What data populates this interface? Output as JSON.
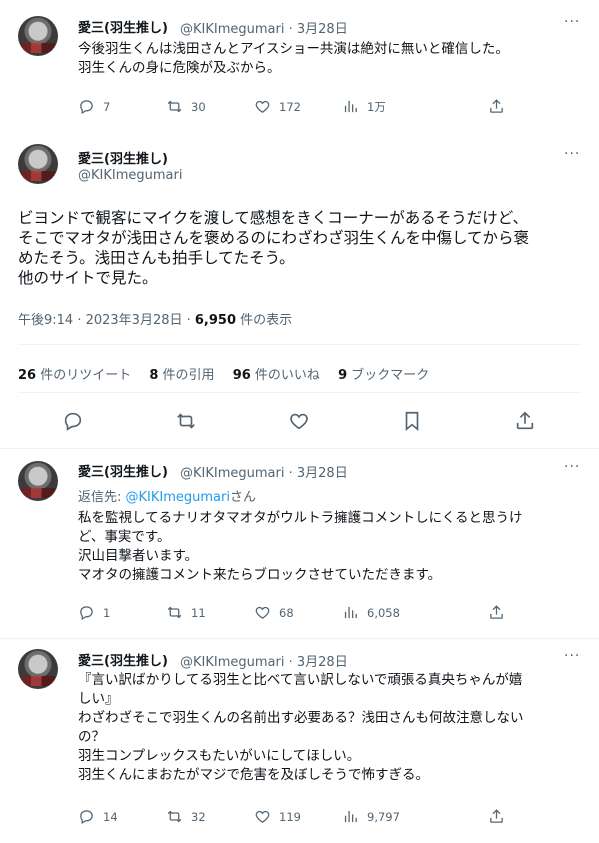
{
  "tweet1": {
    "name": "愛三(羽生推し)",
    "handle": "@KIKImegumari",
    "date": "3月28日",
    "text": "今後羽生くんは浅田さんとアイスショー共演は絶対に無いと確信した。\n羽生くんの身に危険が及ぶから。",
    "replies": "7",
    "retweets": "30",
    "likes": "172",
    "views": "1万"
  },
  "main": {
    "name": "愛三(羽生推し)",
    "handle": "@KIKImegumari",
    "text": "ビヨンドで観客にマイクを渡して感想をきくコーナーがあるそうだけど、\nそこでマオタが浅田さんを褒めるのにわざわざ羽生くんを中傷してから褒\nめたそう。浅田さんも拍手してたそう。\n他のサイトで見た。",
    "timestamp": "午後9:14 · 2023年3月28日 · ",
    "views_count": "6,950",
    "views_label": " 件の表示",
    "retweets_count": "26",
    "retweets_label": " 件のリツイート",
    "quotes_count": "8",
    "quotes_label": " 件の引用",
    "likes_count": "96",
    "likes_label": " 件のいいね",
    "bookmarks_count": "9",
    "bookmarks_label": " ブックマーク"
  },
  "tweet3": {
    "name": "愛三(羽生推し)",
    "handle": "@KIKImegumari",
    "date": "3月28日",
    "reply_prefix": "返信先: ",
    "reply_handle": "@KIKImegumari",
    "reply_suffix": "さん",
    "text": "私を監視してるナリオタマオタがウルトラ擁護コメントしにくると思うけ\nど、事実です。\n沢山目撃者います。\nマオタの擁護コメント来たらブロックさせていただきます。",
    "replies": "1",
    "retweets": "11",
    "likes": "68",
    "views": "6,058"
  },
  "tweet4": {
    "name": "愛三(羽生推し)",
    "handle": "@KIKImegumari",
    "date": "3月28日",
    "text": "『言い訳ばかりしてる羽生と比べて言い訳しないで頑張る真央ちゃんが嬉\nしい』\nわざわざそこで羽生くんの名前出す必要ある？浅田さんも何故注意しない\nの？\n羽生コンプレックスもたいがいにしてほしい。\n羽生くんにまおたがマジで危害を及ぼしそうで怖すぎる。",
    "replies": "14",
    "retweets": "32",
    "likes": "119",
    "views": "9,797"
  },
  "more_icon": "···",
  "dot": " · "
}
